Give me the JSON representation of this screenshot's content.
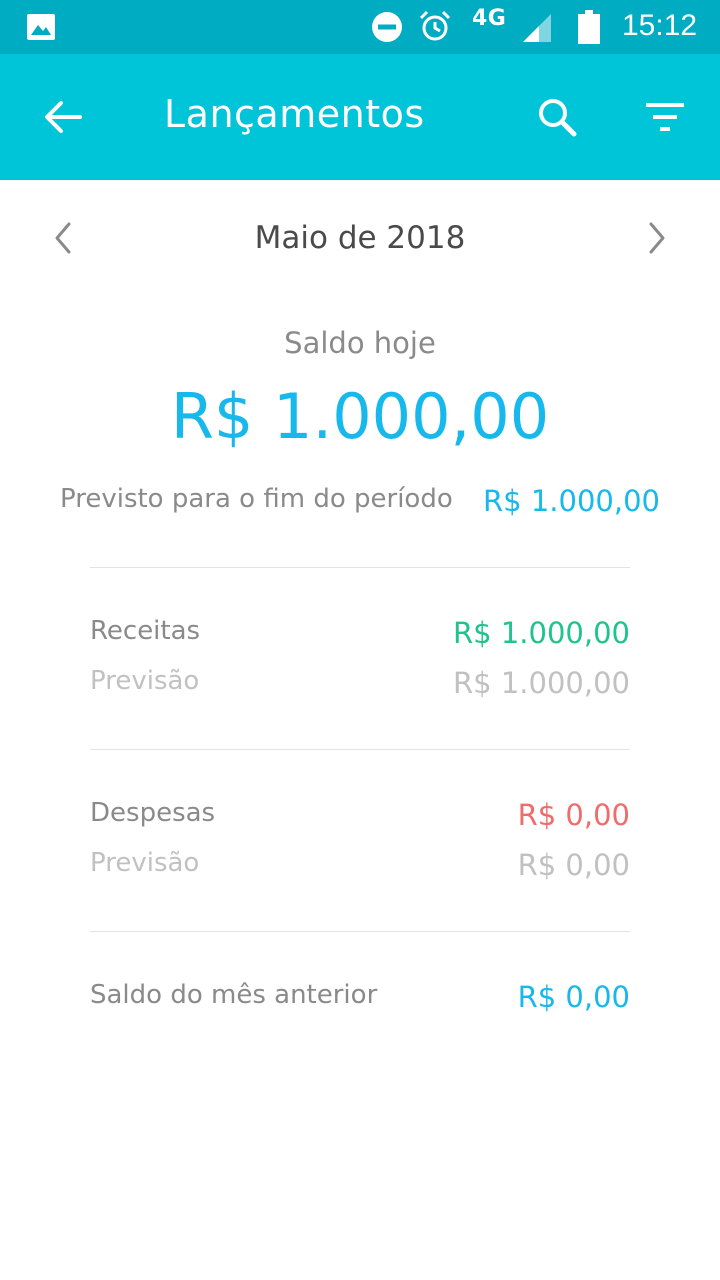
{
  "status_bar": {
    "network": "4G",
    "time": "15:12",
    "icons": [
      "image-icon",
      "do-not-disturb-icon",
      "alarm-icon",
      "signal-icon",
      "battery-icon"
    ]
  },
  "app_bar": {
    "title": "Lançamentos",
    "icons": [
      "back-arrow-icon",
      "search-icon",
      "filter-icon"
    ]
  },
  "month_nav": {
    "label": "Maio de 2018",
    "icons": [
      "chevron-left-icon",
      "chevron-right-icon"
    ]
  },
  "balance": {
    "label": "Saldo hoje",
    "value": "R$ 1.000,00",
    "forecast_label": "Previsto para o fim do período",
    "forecast_value": "R$ 1.000,00"
  },
  "receitas": {
    "label": "Receitas",
    "value": "R$ 1.000,00",
    "forecast_label": "Previsão",
    "forecast_value": "R$ 1.000,00"
  },
  "despesas": {
    "label": "Despesas",
    "value": "R$ 0,00",
    "forecast_label": "Previsão",
    "forecast_value": "R$ 0,00"
  },
  "saldo_anterior": {
    "label": "Saldo do mês anterior",
    "value": "R$ 0,00"
  },
  "colors": {
    "status_bar": "#00acc1",
    "app_bar": "#00c5d8",
    "accent_blue": "#17b8ec",
    "income_green": "#1ec48c",
    "expense_red": "#f26b6b",
    "muted": "#c1c1c1"
  }
}
